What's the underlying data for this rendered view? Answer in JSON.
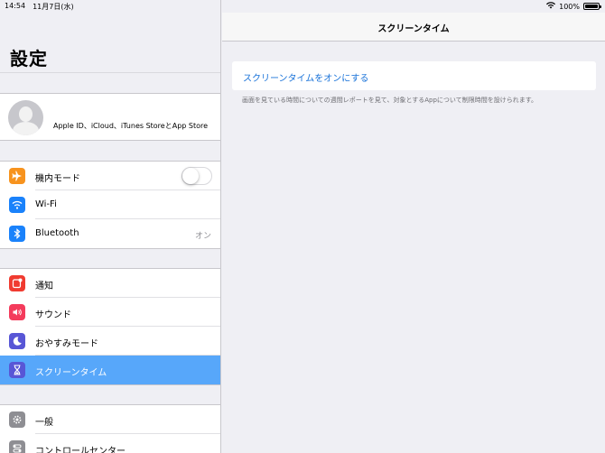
{
  "status_bar": {
    "time": "14:54",
    "date": "11月7日(水)",
    "battery_text": "100%",
    "battery_level": 1.0
  },
  "sidebar": {
    "title": "設定",
    "profile_text": "Apple ID、iCloud、iTunes StoreとApp Store",
    "group1": [
      {
        "label": "機内モード",
        "icon": "airplane-icon",
        "color": "#f7931e",
        "toggle": false
      },
      {
        "label": "Wi-Fi",
        "icon": "wifi-icon",
        "color": "#1a82fb"
      },
      {
        "label": "Bluetooth",
        "icon": "bluetooth-icon",
        "color": "#1a82fb",
        "value": "オン"
      }
    ],
    "group2": [
      {
        "label": "通知",
        "icon": "notification-icon",
        "color": "#f03b30"
      },
      {
        "label": "サウンド",
        "icon": "sound-icon",
        "color": "#f43b5c"
      },
      {
        "label": "おやすみモード",
        "icon": "moon-icon",
        "color": "#5856d6"
      },
      {
        "label": "スクリーンタイム",
        "icon": "hourglass-icon",
        "color": "#5856d6",
        "selected": true
      }
    ],
    "group3": [
      {
        "label": "一般",
        "icon": "gear-icon",
        "color": "#8e8e93"
      },
      {
        "label": "コントロールセンター",
        "icon": "control-center-icon",
        "color": "#8e8e93"
      }
    ]
  },
  "main": {
    "title": "スクリーンタイム",
    "turn_on_label": "スクリーンタイムをオンにする",
    "footnote": "画面を見ている時間についての週間レポートを見て、対象とするAppについて制限時間を設けられます。"
  },
  "colors": {
    "selected_row": "#57a7fa",
    "link": "#1a73d9"
  }
}
